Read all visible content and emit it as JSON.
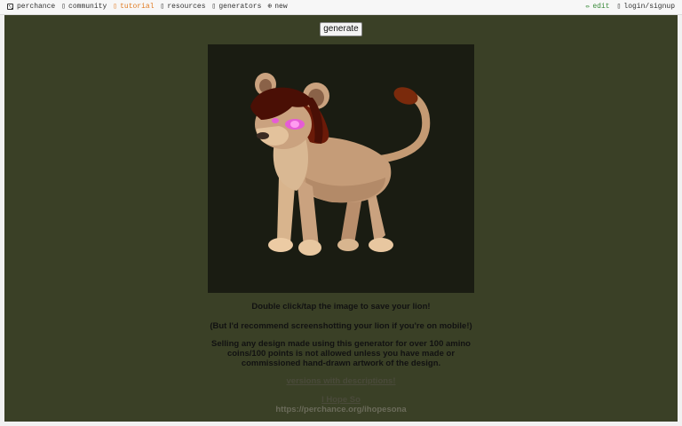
{
  "nav": {
    "left": [
      {
        "icon": "die-icon",
        "label": "perchance"
      },
      {
        "icon": "community-icon",
        "label": "community"
      },
      {
        "icon": "tutorial-icon",
        "label": "tutorial"
      },
      {
        "icon": "resources-icon",
        "label": "resources"
      },
      {
        "icon": "generators-icon",
        "label": "generators"
      },
      {
        "icon": "new-icon",
        "label": "new"
      }
    ],
    "right": [
      {
        "icon": "pencil-icon",
        "label": "edit"
      },
      {
        "icon": "login-icon",
        "label": "login/signup"
      }
    ]
  },
  "main": {
    "generate_label": "generate",
    "line1": "Double click/tap the image to save your lion!",
    "line2": "(But I'd recommend screenshotting your lion if you're on mobile!)",
    "line3": "Selling any design made using this generator for over 100 amino coins/100 points is not allowed unless you have made or commissioned hand-drawn artwork of the design.",
    "versions_link": "versions with descriptions!",
    "author_link": "I Hope So",
    "author_url": "https://perchance.org/ihopesona"
  },
  "colors": {
    "background": "#3a4026",
    "canvas": "#1a1c12",
    "tutorial": "#e07b22",
    "edit": "#3a8a3a"
  }
}
